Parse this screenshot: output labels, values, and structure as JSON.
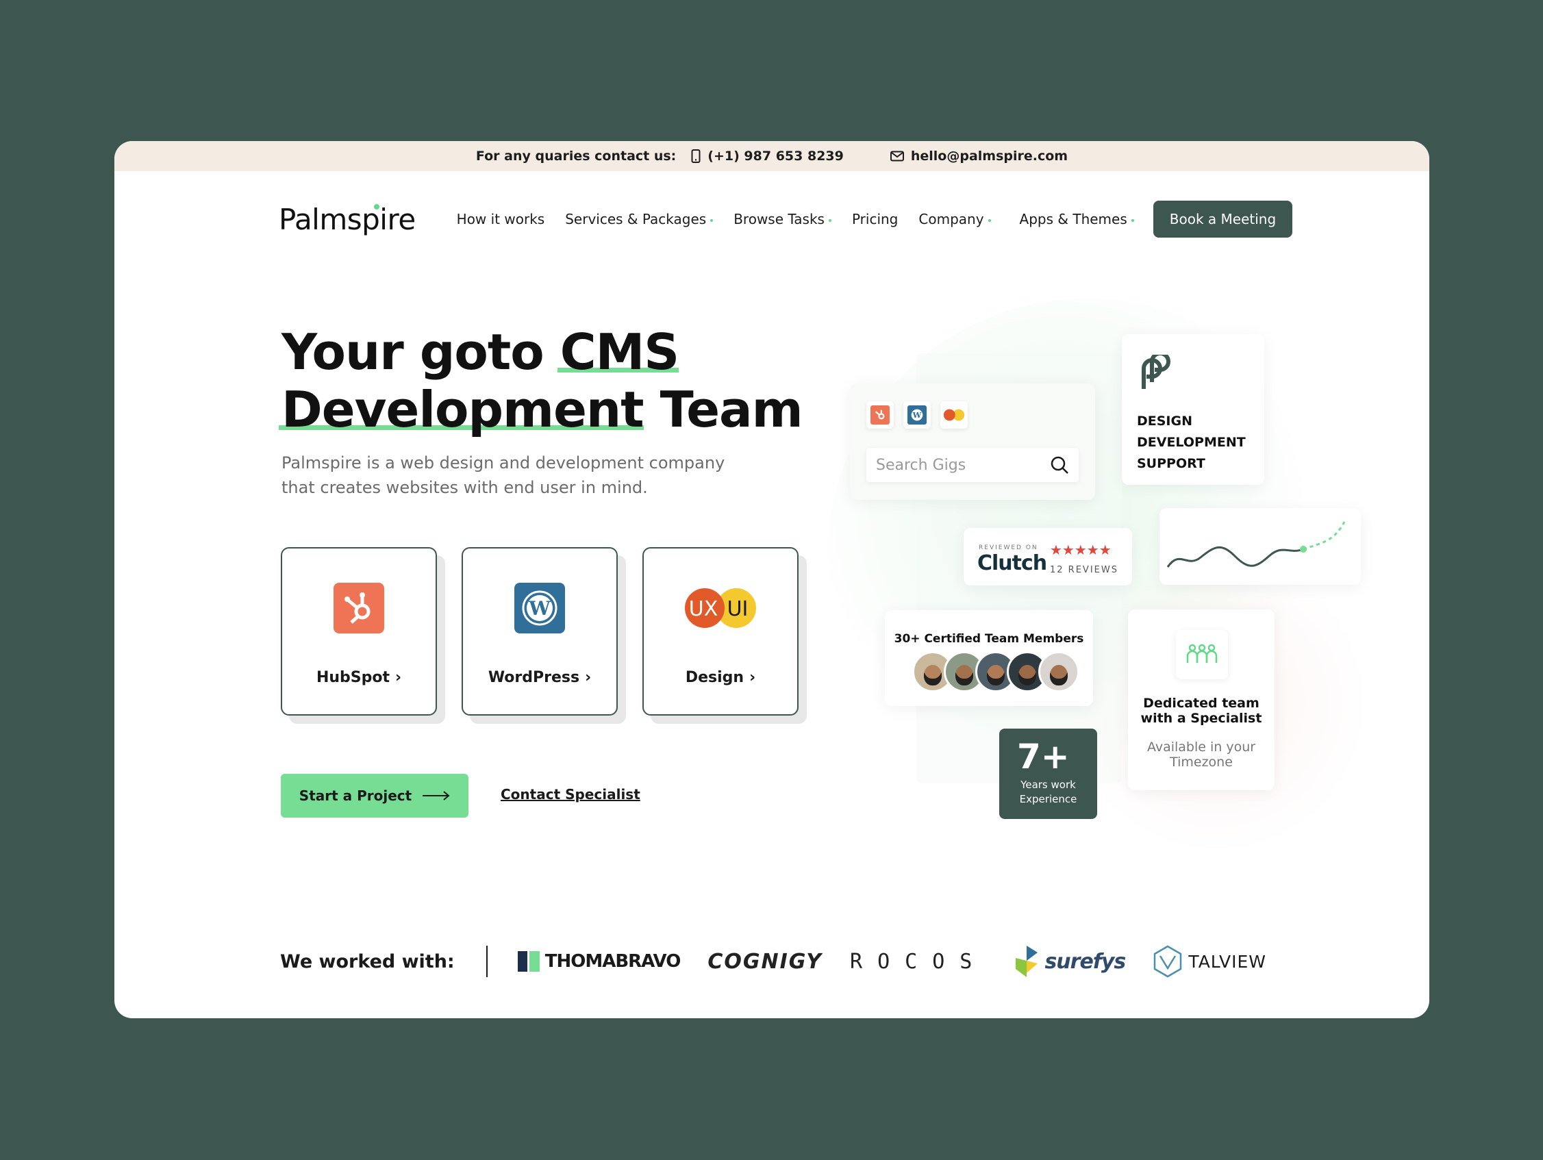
{
  "topbar": {
    "contact_label": "For any quaries contact us:",
    "phone": "(+1) 987 653 8239",
    "email": "hello@palmspire.com"
  },
  "nav": {
    "logo": "Palmspire",
    "items": [
      {
        "label": "How it works",
        "has_dropdown": false
      },
      {
        "label": "Services & Packages",
        "has_dropdown": true
      },
      {
        "label": "Browse Tasks",
        "has_dropdown": true
      },
      {
        "label": "Pricing",
        "has_dropdown": false
      },
      {
        "label": "Company",
        "has_dropdown": true
      }
    ],
    "apps_label": "Apps & Themes",
    "cta": "Book a Meeting"
  },
  "hero": {
    "title_part1": "Your goto ",
    "title_highlight1": "CMS",
    "title_highlight2": "Development",
    "title_part2": " Team",
    "subtitle": "Palmspire is a web design and development company that creates websites with end user in mind.",
    "cards": [
      {
        "label": "HubSpot",
        "icon": "hubspot-icon",
        "color": "#ef7456"
      },
      {
        "label": "WordPress",
        "icon": "wordpress-icon",
        "color": "#2f6f9a"
      },
      {
        "label": "Design",
        "icon": "ux-ui-icon",
        "color": "#e25a2a"
      }
    ],
    "primary_cta": "Start a Project",
    "secondary_cta": "Contact Specialist"
  },
  "visuals": {
    "search_placeholder": "Search Gigs",
    "dds_lines": [
      "DESIGN",
      "DEVELOPMENT",
      "SUPPORT"
    ],
    "clutch": {
      "reviewed_on": "REVIEWED ON",
      "name": "Clutch",
      "stars": "★★★★★",
      "reviews": "12 REVIEWS"
    },
    "team_title": "30+ Certified Team Members",
    "experience": {
      "number": "7+",
      "label": "Years work Experience"
    },
    "dedicated": {
      "title": "Dedicated team with a Specialist",
      "subtitle": "Available in your Timezone"
    }
  },
  "clients": {
    "label": "We worked with:",
    "logos": [
      "THOMABRAVO",
      "COGNIGY",
      "ROCOS",
      "surefys",
      "TALVIEW"
    ]
  },
  "colors": {
    "background": "#3d564f",
    "accent_green": "#77dc94",
    "dark_green": "#3d564f",
    "topbar": "#f4ebe3"
  }
}
